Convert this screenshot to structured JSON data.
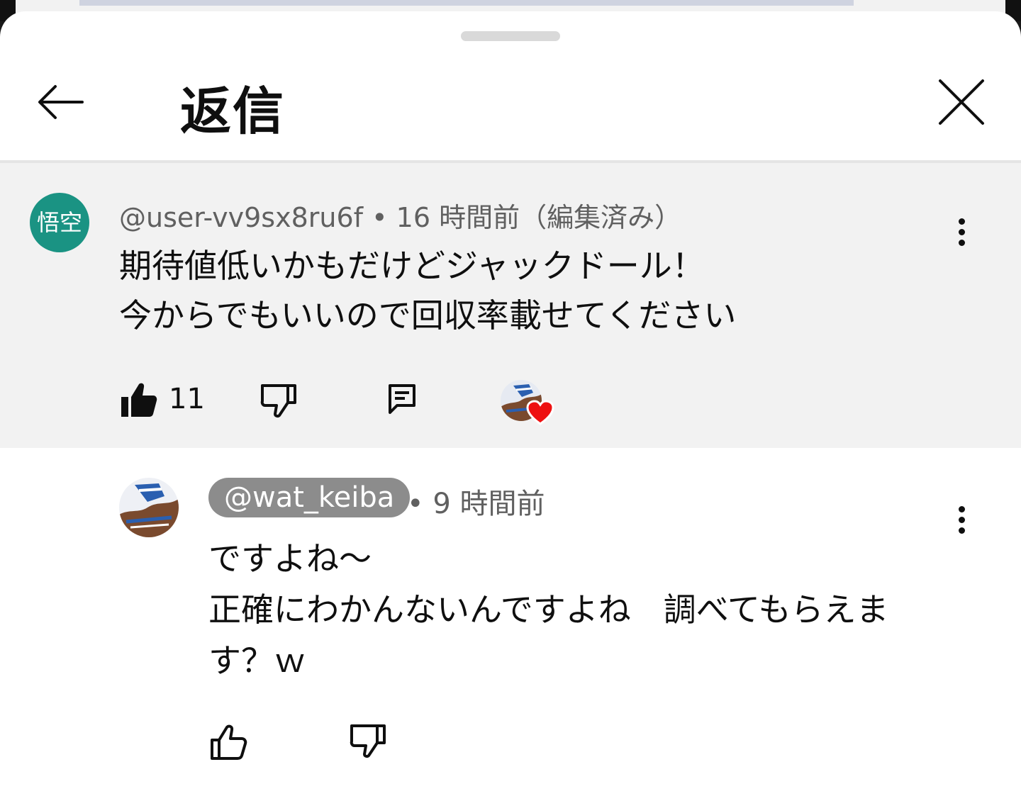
{
  "header": {
    "title": "返信"
  },
  "parent_comment": {
    "avatar_text": "悟空",
    "author": "@user-vv9sx8ru6f",
    "separator": "•",
    "time": "16 時間前（編集済み）",
    "lines": [
      "期待値低いかもだけどジャックドール！",
      "今からでもいいので回収率載せてください"
    ],
    "like_count": "11"
  },
  "reply_comment": {
    "author": "@wat_keiba",
    "separator": "•",
    "time": "9 時間前",
    "lines": [
      "ですよね〜",
      "正確にわかんないんですよね　調べてもらえま",
      "す？ｗ"
    ]
  },
  "colors": {
    "avatar_bg": "#1a9383",
    "heart": "#ee1111",
    "parent_bg": "#f2f2f2",
    "author_chip_bg": "#8c8c8c"
  },
  "icons": {
    "back": "arrow-left-icon",
    "close": "close-icon",
    "more": "more-vert-icon",
    "like": "thumb-up-icon",
    "dislike": "thumb-down-icon",
    "reply": "comment-icon",
    "creator_heart": "heart-icon"
  }
}
